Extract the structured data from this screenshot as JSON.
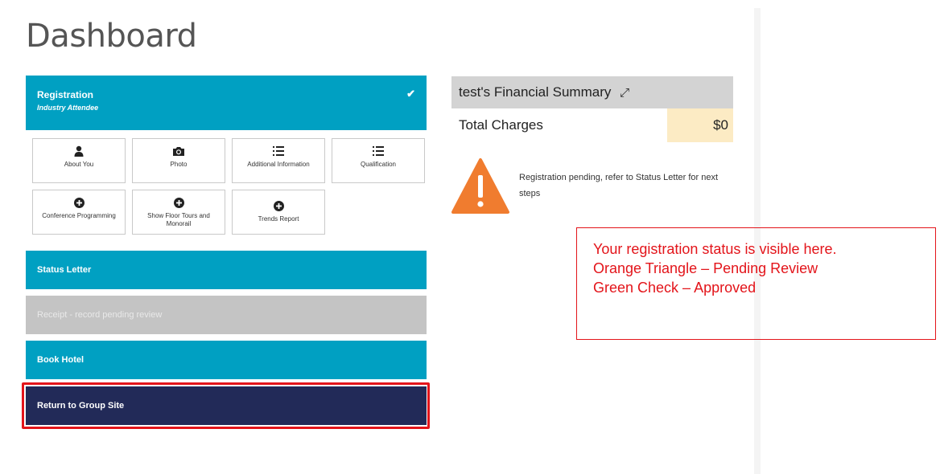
{
  "page": {
    "title": "Dashboard"
  },
  "registration": {
    "title": "Registration",
    "subtitle": "Industry Attendee",
    "check": "✔",
    "tiles": [
      {
        "label": "About You",
        "icon": "person-icon",
        "glyph": "👤"
      },
      {
        "label": "Photo",
        "icon": "camera-icon",
        "glyph": "📷"
      },
      {
        "label": "Additional Information",
        "icon": "list-icon",
        "glyph": "☰"
      },
      {
        "label": "Qualification",
        "icon": "list-icon",
        "glyph": "☰"
      },
      {
        "label": "Conference Programming",
        "icon": "plus-circle-icon",
        "glyph": "⊕"
      },
      {
        "label": "Show Floor Tours and Monorail",
        "icon": "plus-circle-icon",
        "glyph": "⊕"
      },
      {
        "label": "Trends Report",
        "icon": "plus-circle-icon",
        "glyph": "⊕"
      }
    ]
  },
  "bars": {
    "status_letter": "Status Letter",
    "receipt": "Receipt - record pending review",
    "book_hotel": "Book Hotel",
    "return_group": "Return to Group Site"
  },
  "financial": {
    "title": "test's Financial Summary",
    "expand_glyph": "⤢",
    "total_label": "Total Charges",
    "total_value": "$0"
  },
  "status": {
    "pending_text": "Registration pending, refer to Status Letter for next steps"
  },
  "callout": {
    "lines": [
      "Your registration status is visible here.",
      "Orange Triangle – Pending Review",
      "Green Check – Approved"
    ]
  },
  "colors": {
    "teal": "#00a0c2",
    "navy": "#222a58",
    "warning_orange": "#f07c2f",
    "annotation_red": "#e3141a"
  }
}
